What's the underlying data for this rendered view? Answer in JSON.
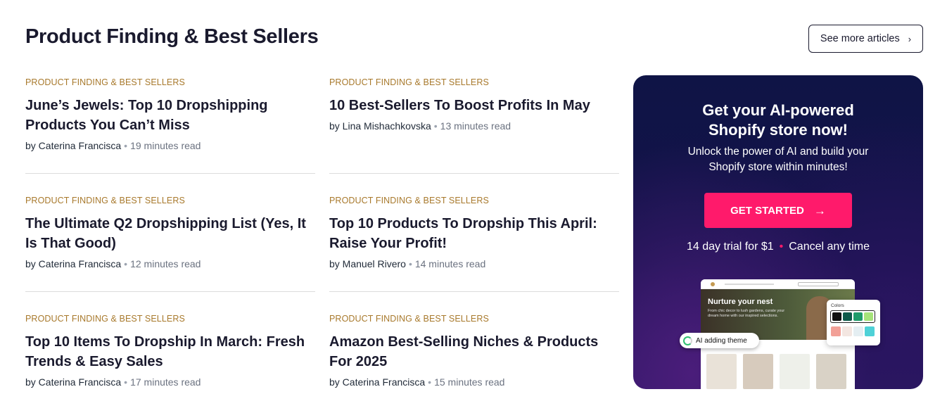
{
  "header": {
    "title": "Product Finding & Best Sellers",
    "see_more_label": "See more articles",
    "see_more_icon": "chevron-right-icon"
  },
  "articles": [
    {
      "category": "PRODUCT FINDING & BEST SELLERS",
      "title": "June’s Jewels: Top 10 Dropshipping Products You Can’t Miss",
      "author": "by Caterina Francisca",
      "read_time": "19 minutes read"
    },
    {
      "category": "PRODUCT FINDING & BEST SELLERS",
      "title": "10 Best-Sellers To Boost Profits In May",
      "author": "by Lina Mishachkovska",
      "read_time": "13 minutes read"
    },
    {
      "category": "PRODUCT FINDING & BEST SELLERS",
      "title": "The Ultimate Q2 Dropshipping List (Yes, It Is That Good)",
      "author": "by Caterina Francisca",
      "read_time": "12 minutes read"
    },
    {
      "category": "PRODUCT FINDING & BEST SELLERS",
      "title": "Top 10 Products To Dropship This April: Raise Your Profit!",
      "author": "by Manuel Rivero",
      "read_time": "14 minutes read"
    },
    {
      "category": "PRODUCT FINDING & BEST SELLERS",
      "title": "Top 10 Items To Dropship In March: Fresh Trends & Easy Sales",
      "author": "by Caterina Francisca",
      "read_time": "17 minutes read"
    },
    {
      "category": "PRODUCT FINDING & BEST SELLERS",
      "title": "Amazon Best-Selling Niches & Products For 2025",
      "author": "by Caterina Francisca",
      "read_time": "15 minutes read"
    }
  ],
  "meta_separator": "•",
  "promo": {
    "title": "Get your AI-powered Shopify store now!",
    "subtitle": "Unlock the power of AI and build your Shopify store within minutes!",
    "cta_label": "GET STARTED",
    "cta_icon": "arrow-right-icon",
    "trial_text": "14 day trial for $1",
    "cancel_text": "Cancel any time",
    "separator": "•",
    "mockup": {
      "hero_title": "Nurture your nest",
      "hero_text": "From chic decor to lush gardens, curate your dream home with our inspired selections.",
      "colors_label": "Colors",
      "ai_chip_label": "AI adding theme"
    },
    "colors": {
      "accent": "#ff1a6b",
      "background": "#0f1446",
      "palette_row1": [
        "#111111",
        "#0f5a4a",
        "#1f9b6a",
        "#a6e37a"
      ],
      "palette_row2": [
        "#f2a097",
        "#f3e6e1",
        "#e4eef2",
        "#4ed1d7"
      ],
      "products": [
        "#e9e2d8",
        "#d7cbbd",
        "#eef0ea",
        "#d9d2c6"
      ]
    }
  },
  "colors": {
    "category": "#a8792c",
    "title": "#1a1a2e",
    "meta": "#6b7280"
  }
}
